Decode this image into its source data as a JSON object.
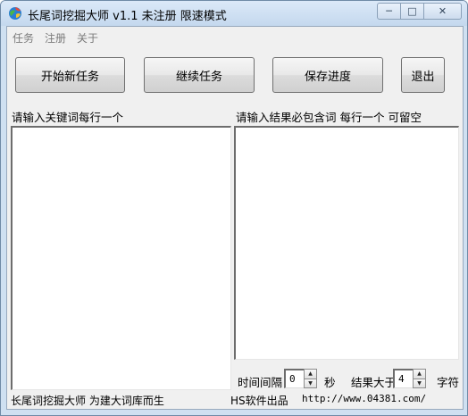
{
  "window": {
    "title": "长尾词挖掘大师 v1.1  未注册  限速模式",
    "icon": "colorful-globe-icon",
    "controls": {
      "minimize": "─",
      "maximize": "□",
      "close": "✕"
    }
  },
  "menu": [
    "任务",
    "注册",
    "关于"
  ],
  "toolbar": {
    "start_new_task": "开始新任务",
    "continue_task": "继续任务",
    "save_progress": "保存进度",
    "exit": "退出"
  },
  "left_panel": {
    "label": "请输入关键词每行一个",
    "value": ""
  },
  "right_panel": {
    "label": "请输入结果必包含词   每行一个 可留空",
    "value": ""
  },
  "interval": {
    "label": "时间间隔",
    "value": "0",
    "unit": "秒"
  },
  "result_min": {
    "label": "结果大于",
    "value": "4",
    "unit": "字符"
  },
  "status": {
    "app_slogan": "长尾词挖掘大师   为建大词库而生",
    "publisher": "HS软件出品",
    "url": "http://www.04381.com/"
  },
  "colors": {
    "title_bg": "#cfe0f1",
    "client_bg": "#f0f0f0",
    "menu_text": "#7a7a7a"
  }
}
